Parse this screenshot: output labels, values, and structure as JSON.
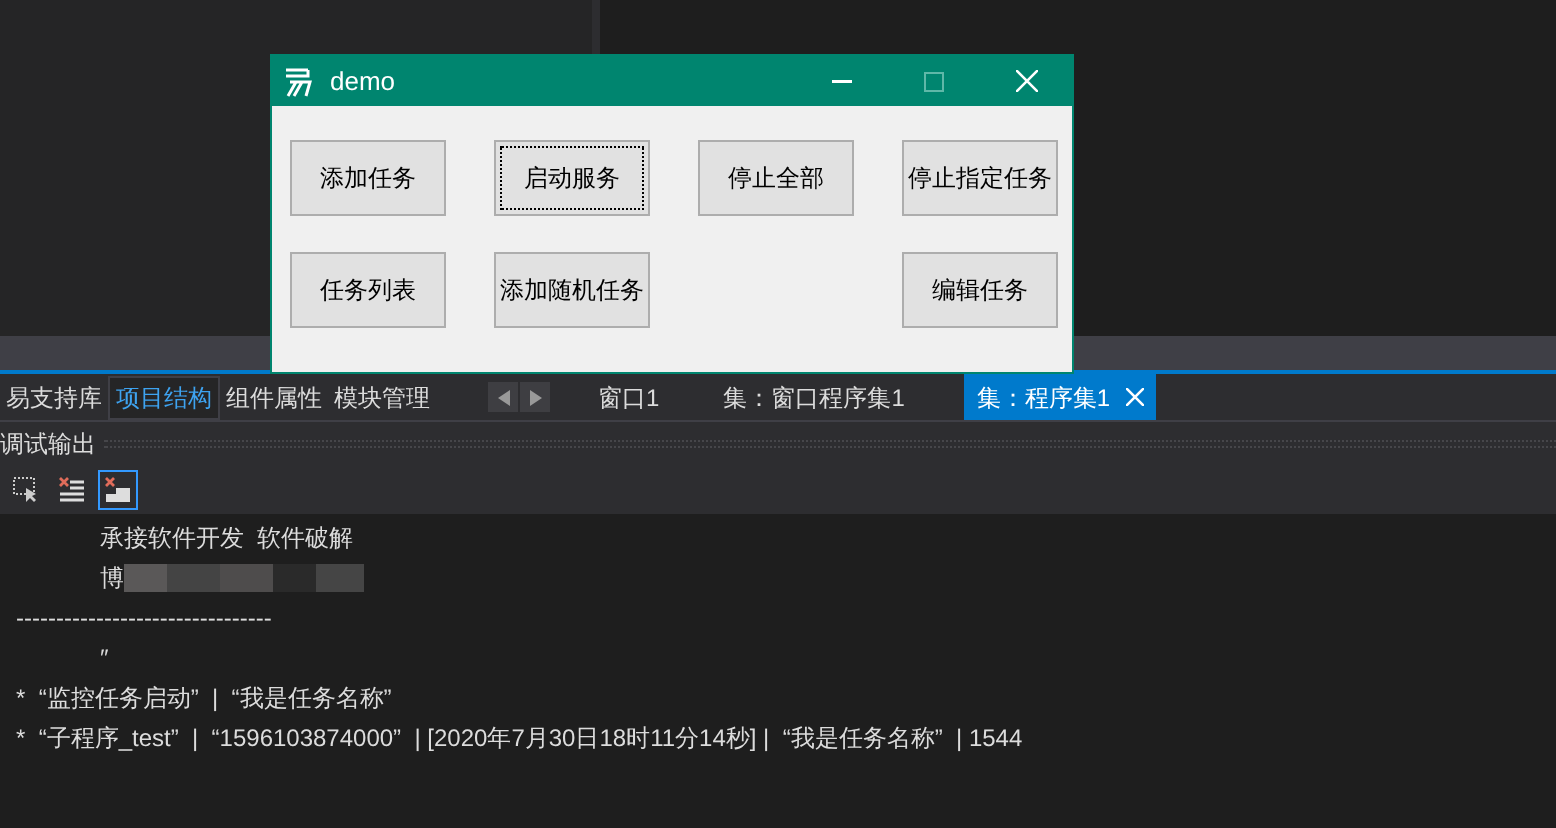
{
  "dialog": {
    "title": "demo",
    "rows": [
      [
        {
          "kind": "button",
          "label": "添加任务",
          "focused": false
        },
        {
          "kind": "button",
          "label": "启动服务",
          "focused": true
        },
        {
          "kind": "button",
          "label": "停止全部",
          "focused": false
        },
        {
          "kind": "button",
          "label": "停止指定任务",
          "focused": false
        }
      ],
      [
        {
          "kind": "button",
          "label": "任务列表",
          "focused": false
        },
        {
          "kind": "button",
          "label": "添加随机任务",
          "focused": false
        },
        {
          "kind": "empty"
        },
        {
          "kind": "button",
          "label": "编辑任务",
          "focused": false
        }
      ]
    ]
  },
  "panel_tabs": [
    {
      "label": "易支持库",
      "selected": false
    },
    {
      "label": "项目结构",
      "selected": true
    },
    {
      "label": "组件属性",
      "selected": false
    },
    {
      "label": "模块管理",
      "selected": false
    }
  ],
  "doc_tabs": [
    {
      "label": "窗口1",
      "selected": false
    },
    {
      "label": "集：窗口程序集1",
      "selected": false
    },
    {
      "label": "集：程序集1",
      "selected": true
    }
  ],
  "output": {
    "title": "调试输出",
    "tools": [
      {
        "kind": "select",
        "selected": false
      },
      {
        "kind": "clear-list",
        "selected": false
      },
      {
        "kind": "clear-chart",
        "selected": true
      }
    ],
    "lines": [
      {
        "kind": "indent",
        "text": "承接软件开发  软件破解"
      },
      {
        "kind": "redacted",
        "text": "博"
      },
      {
        "kind": "plain",
        "text": "--------------------------------"
      },
      {
        "kind": "indent",
        "text": "″"
      },
      {
        "kind": "plain",
        "text": "*  “监控任务启动”  |  “我是任务名称”"
      },
      {
        "kind": "plain",
        "text": "*  “子程序_test”  |  “1596103874000”  | [2020年7月30日18时11分14秒] |  “我是任务名称”  | 1544"
      }
    ]
  }
}
